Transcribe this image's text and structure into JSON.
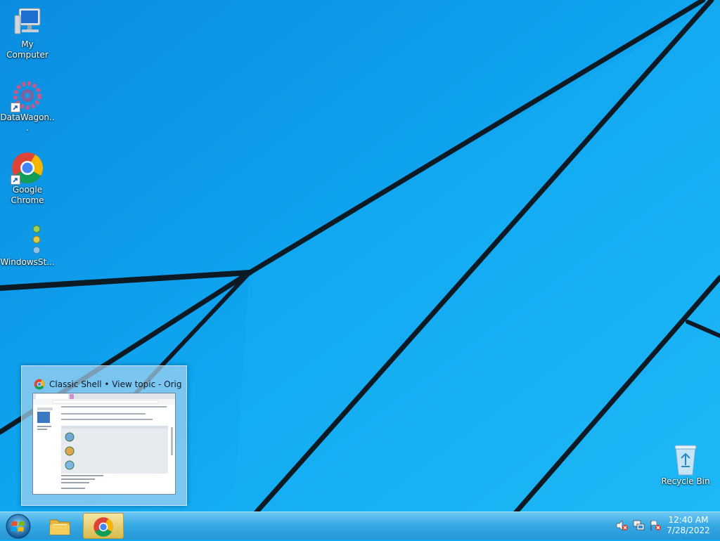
{
  "desktop": {
    "icons": [
      {
        "name": "my-computer",
        "label": "My Computer"
      },
      {
        "name": "datawagon",
        "label": "DataWagon..."
      },
      {
        "name": "google-chrome",
        "label": "Google\nChrome"
      },
      {
        "name": "windows-st",
        "label": "WindowsSt..."
      },
      {
        "name": "recycle-bin",
        "label": "Recycle Bin"
      }
    ]
  },
  "thumbnail": {
    "title": "Classic Shell • View topic - Origi...",
    "icon": "chrome-icon"
  },
  "taskbar": {
    "start_icon": "windows-logo-icon",
    "pinned": [
      {
        "name": "file-explorer",
        "icon": "folder-icon"
      },
      {
        "name": "google-chrome",
        "icon": "chrome-icon",
        "active": true
      }
    ],
    "tray_icons": [
      "speaker-muted-icon",
      "network-icon",
      "action-center-flag-icon"
    ],
    "clock": {
      "time": "12:40 AM",
      "date": "7/28/2022"
    }
  },
  "colors": {
    "wallpaper": "#13a7f2",
    "wallpaper_lines": "#0b1a24",
    "taskbar": "#35a8e4",
    "active_task": "#e0c35e"
  }
}
